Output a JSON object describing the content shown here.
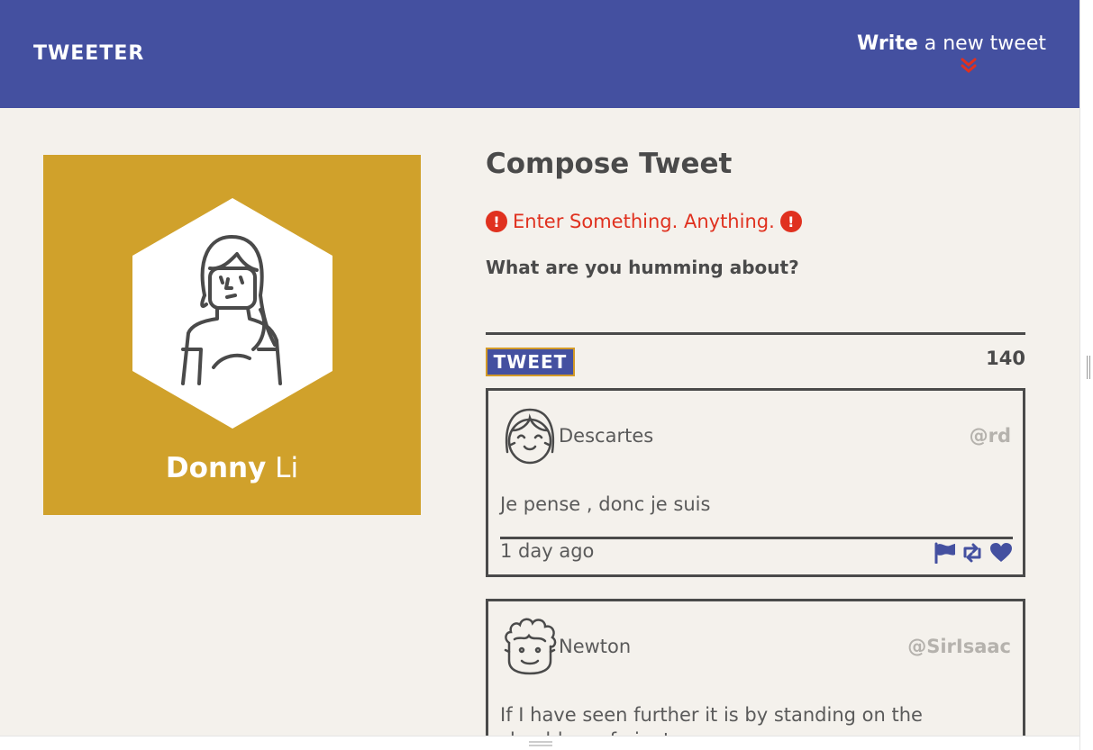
{
  "nav": {
    "logo": "TWEETER",
    "write_strong": "Write",
    "write_rest": " a new tweet"
  },
  "profile": {
    "first_name": "Donny",
    "last_name": " Li",
    "card_color": "#d0a12b"
  },
  "compose": {
    "title": "Compose Tweet",
    "error": "Enter Something. Anything.",
    "prompt": "What are you humming about?",
    "input_value": "",
    "tweet_button": "TWEET",
    "counter": "140"
  },
  "tweets": [
    {
      "name": "Descartes",
      "handle": "@rd",
      "text": "Je pense , donc je suis",
      "time": "1 day ago",
      "avatar_icon": "girl-avatar-icon"
    },
    {
      "name": "Newton",
      "handle": "@SirIsaac",
      "text": "If I have seen further it is by standing on the shoulders of giants",
      "avatar_icon": "curly-hair-avatar-icon"
    }
  ],
  "colors": {
    "nav": "#4450a0",
    "background": "#f4f1ec",
    "error": "#e0311f",
    "accent": "#d39a27",
    "text": "#4a4a4a"
  }
}
